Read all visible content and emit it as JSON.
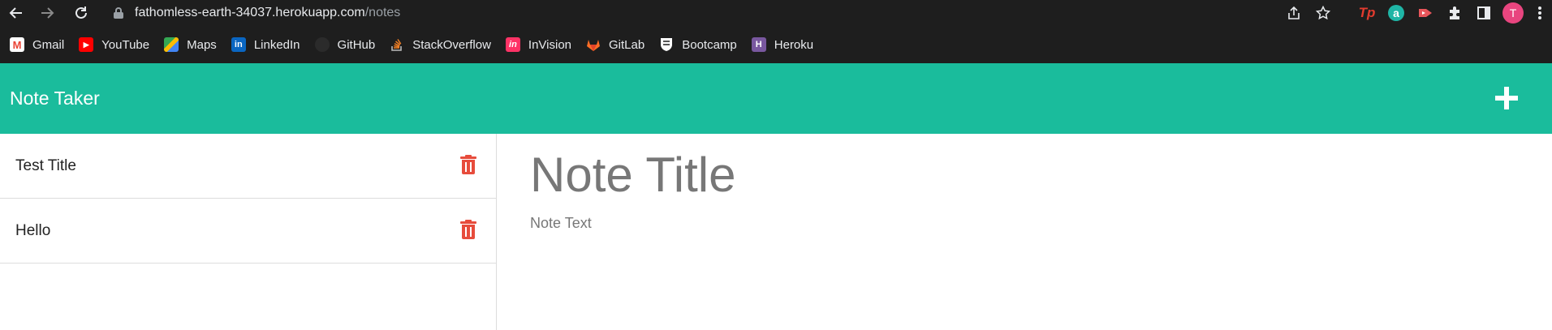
{
  "browser": {
    "url_host": "fathomless-earth-34037.herokuapp.com",
    "url_path": "/notes",
    "avatar_letter": "T",
    "extensions": {
      "tp_label": "Tp",
      "a_label": "a"
    }
  },
  "bookmarks": [
    {
      "label": "Gmail",
      "icon": "gmail-icon",
      "color": "#ea4335"
    },
    {
      "label": "YouTube",
      "icon": "youtube-icon",
      "color": "#ff0000"
    },
    {
      "label": "Maps",
      "icon": "maps-icon",
      "color": "#34a853"
    },
    {
      "label": "LinkedIn",
      "icon": "linkedin-icon",
      "color": "#0a66c2"
    },
    {
      "label": "GitHub",
      "icon": "github-icon",
      "color": "#333333"
    },
    {
      "label": "StackOverflow",
      "icon": "stackoverflow-icon",
      "color": "#f48024"
    },
    {
      "label": "InVision",
      "icon": "invision-icon",
      "color": "#ff3366"
    },
    {
      "label": "GitLab",
      "icon": "gitlab-icon",
      "color": "#fc6d26"
    },
    {
      "label": "Bootcamp",
      "icon": "bootcamp-icon",
      "color": "#ffffff"
    },
    {
      "label": "Heroku",
      "icon": "heroku-icon",
      "color": "#79589f"
    }
  ],
  "app": {
    "title": "Note Taker",
    "accent": "#1abc9c",
    "delete_color": "#e74c3c"
  },
  "notes": [
    {
      "title": "Test Title"
    },
    {
      "title": "Hello"
    }
  ],
  "editor": {
    "title_placeholder": "Note Title",
    "text_placeholder": "Note Text"
  }
}
